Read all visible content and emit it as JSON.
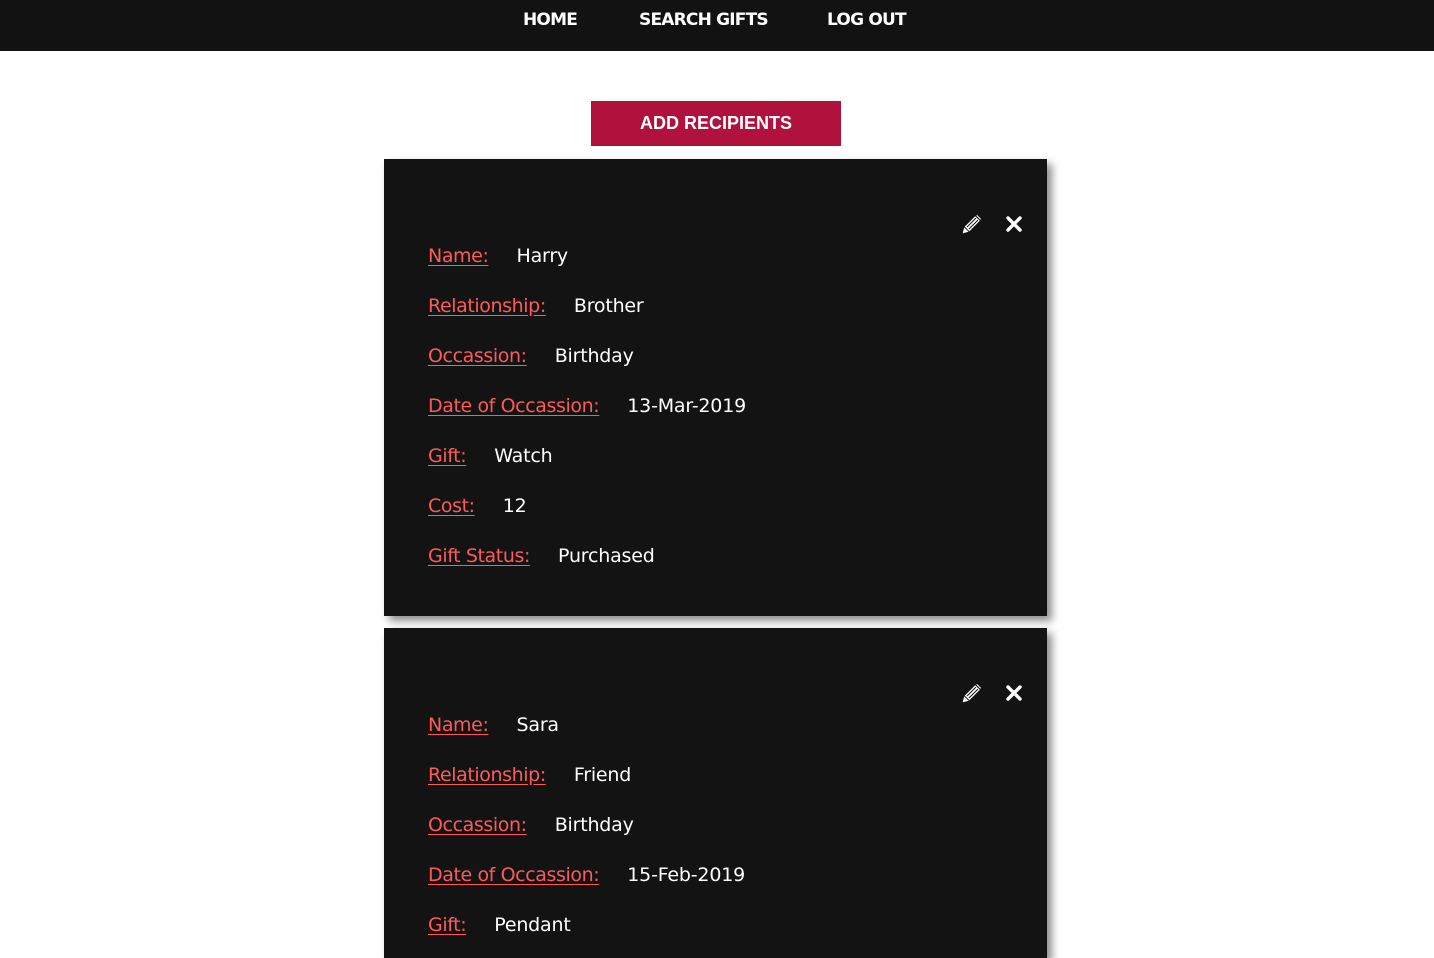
{
  "nav": {
    "home": "HOME",
    "search_gifts": "SEARCH GIFTS",
    "log_out": "LOG OUT"
  },
  "add_recipients_label": "ADD RECIPIENTS",
  "icons": {
    "edit": "pencil-icon",
    "delete": "close-icon"
  },
  "colors": {
    "nav_bg": "#121212",
    "button_bg": "#b0123d",
    "card_bg": "#131313",
    "label": "#ff5a5a",
    "value": "#ffffff"
  },
  "labels": {
    "name": "Name:",
    "relationship": "Relationship:",
    "occasion": "Occassion:",
    "date": "Date of Occassion:",
    "gift": "Gift:",
    "cost": "Cost:",
    "status": "Gift Status:"
  },
  "recipients": [
    {
      "name": "Harry",
      "relationship": "Brother",
      "occasion": "Birthday",
      "date": "13-Mar-2019",
      "gift": "Watch",
      "cost": "12",
      "status": "Purchased"
    },
    {
      "name": "Sara",
      "relationship": "Friend",
      "occasion": "Birthday",
      "date": "15-Feb-2019",
      "gift": "Pendant"
    }
  ]
}
